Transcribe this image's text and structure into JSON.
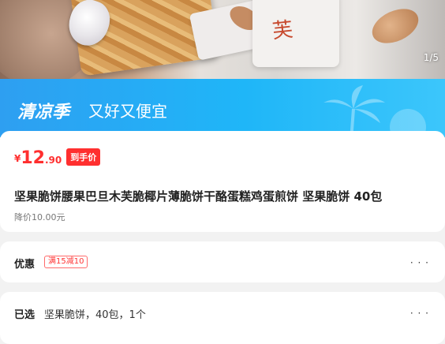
{
  "gallery": {
    "page_indicator": "1/5",
    "pack_text": "芙"
  },
  "banner": {
    "title": "清凉季",
    "subtitle": "又好又便宜"
  },
  "price": {
    "symbol": "¥",
    "integer": "12",
    "decimal": ".90",
    "tag": "到手价"
  },
  "product": {
    "title": "坚果脆饼腰果巴旦木芙脆椰片薄脆饼干酪蛋糕鸡蛋煎饼 坚果脆饼 40包",
    "original_price": "降价10.00元"
  },
  "promo": {
    "label": "优惠",
    "badge": "满15减10",
    "more": "· · ·"
  },
  "selection": {
    "label": "已选",
    "value": "坚果脆饼，40包，1个",
    "more": "· · ·"
  },
  "colors": {
    "accent": "#ff2f2f",
    "banner": "#1fb6f8"
  }
}
